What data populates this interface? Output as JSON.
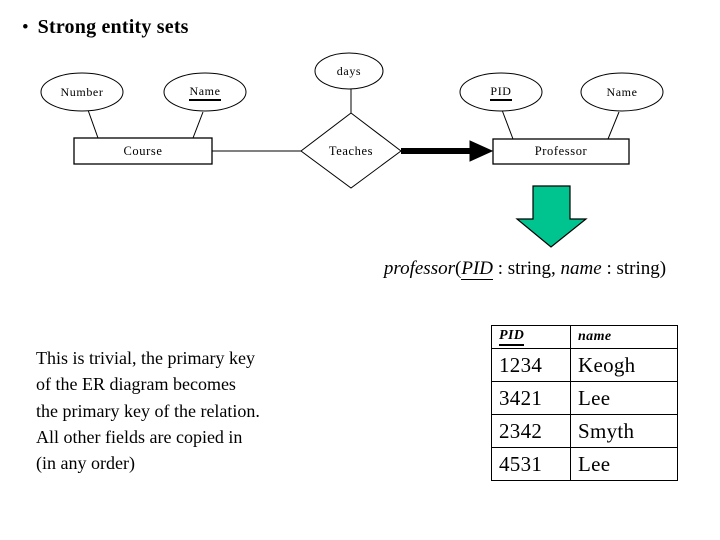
{
  "slide": {
    "title_bullet": "•",
    "title": "Strong entity sets",
    "background_color": "#ffffff",
    "ink_color": "#000000",
    "accent_color": "#00c48f"
  },
  "er_diagram": {
    "entities": [
      {
        "id": "course",
        "label": "Course",
        "shape": "rectangle"
      },
      {
        "id": "professor",
        "label": "Professor",
        "shape": "rectangle"
      }
    ],
    "relationships": [
      {
        "id": "teaches",
        "label": "Teaches",
        "shape": "diamond"
      }
    ],
    "attributes": [
      {
        "id": "number",
        "label": "Number",
        "shape": "ellipse",
        "key": false,
        "owner": "course"
      },
      {
        "id": "course-name",
        "label": "Name",
        "shape": "ellipse",
        "key": true,
        "owner": "course"
      },
      {
        "id": "days",
        "label": "days",
        "shape": "ellipse",
        "key": false,
        "owner": "teaches"
      },
      {
        "id": "pid",
        "label": "PID",
        "shape": "ellipse",
        "key": true,
        "owner": "professor"
      },
      {
        "id": "professor-name",
        "label": "Name",
        "shape": "ellipse",
        "key": false,
        "owner": "professor"
      }
    ],
    "edges": [
      {
        "from": "course",
        "to": "teaches",
        "style": "thin"
      },
      {
        "from": "teaches",
        "to": "professor",
        "style": "thick-arrow"
      }
    ]
  },
  "transform_arrow": {
    "direction": "down",
    "color": "#00c48f",
    "outline_color": "#000000"
  },
  "schema": {
    "relation_name": "professor",
    "open_paren": "(",
    "key_field": "PID",
    "key_type": " : string,",
    "second_field": "name",
    "second_type": " : string",
    "close_paren": ")"
  },
  "explanation": {
    "lines": [
      "This is trivial, the primary key",
      "of the ER diagram becomes",
      "the primary key of the relation.",
      "All other fields are copied in",
      "(in any order)"
    ]
  },
  "relation_table": {
    "headers": [
      "PID",
      "name"
    ],
    "header_key_index": 0,
    "rows": [
      [
        "1234",
        "Keogh"
      ],
      [
        "3421",
        "Lee"
      ],
      [
        "2342",
        "Smyth"
      ],
      [
        "4531",
        "Lee"
      ]
    ]
  }
}
